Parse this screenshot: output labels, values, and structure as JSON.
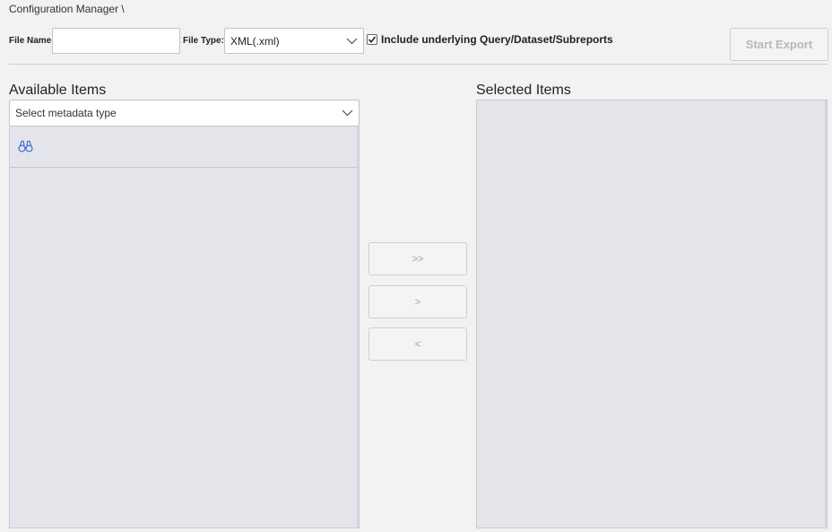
{
  "breadcrumb": "Configuration Manager \\",
  "toolbar": {
    "file_name_label": "File Name",
    "file_name_value": "",
    "file_type_label": "File Type:",
    "file_type_value": "XML(.xml)",
    "include_checked": true,
    "include_label": "Include underlying Query/Dataset/Subreports",
    "start_export_label": "Start Export"
  },
  "available": {
    "title": "Available Items",
    "metadata_select_value": "Select metadata type",
    "search_icon": "binoculars-icon"
  },
  "transfer": {
    "move_all_label": ">>",
    "move_one_label": ">",
    "move_back_label": "<"
  },
  "selected": {
    "title": "Selected Items"
  },
  "colors": {
    "background": "#f2f2f2",
    "panel": "#e3e5ea",
    "disabled_text": "#b8b8b8",
    "accent": "#4a6fd0"
  }
}
